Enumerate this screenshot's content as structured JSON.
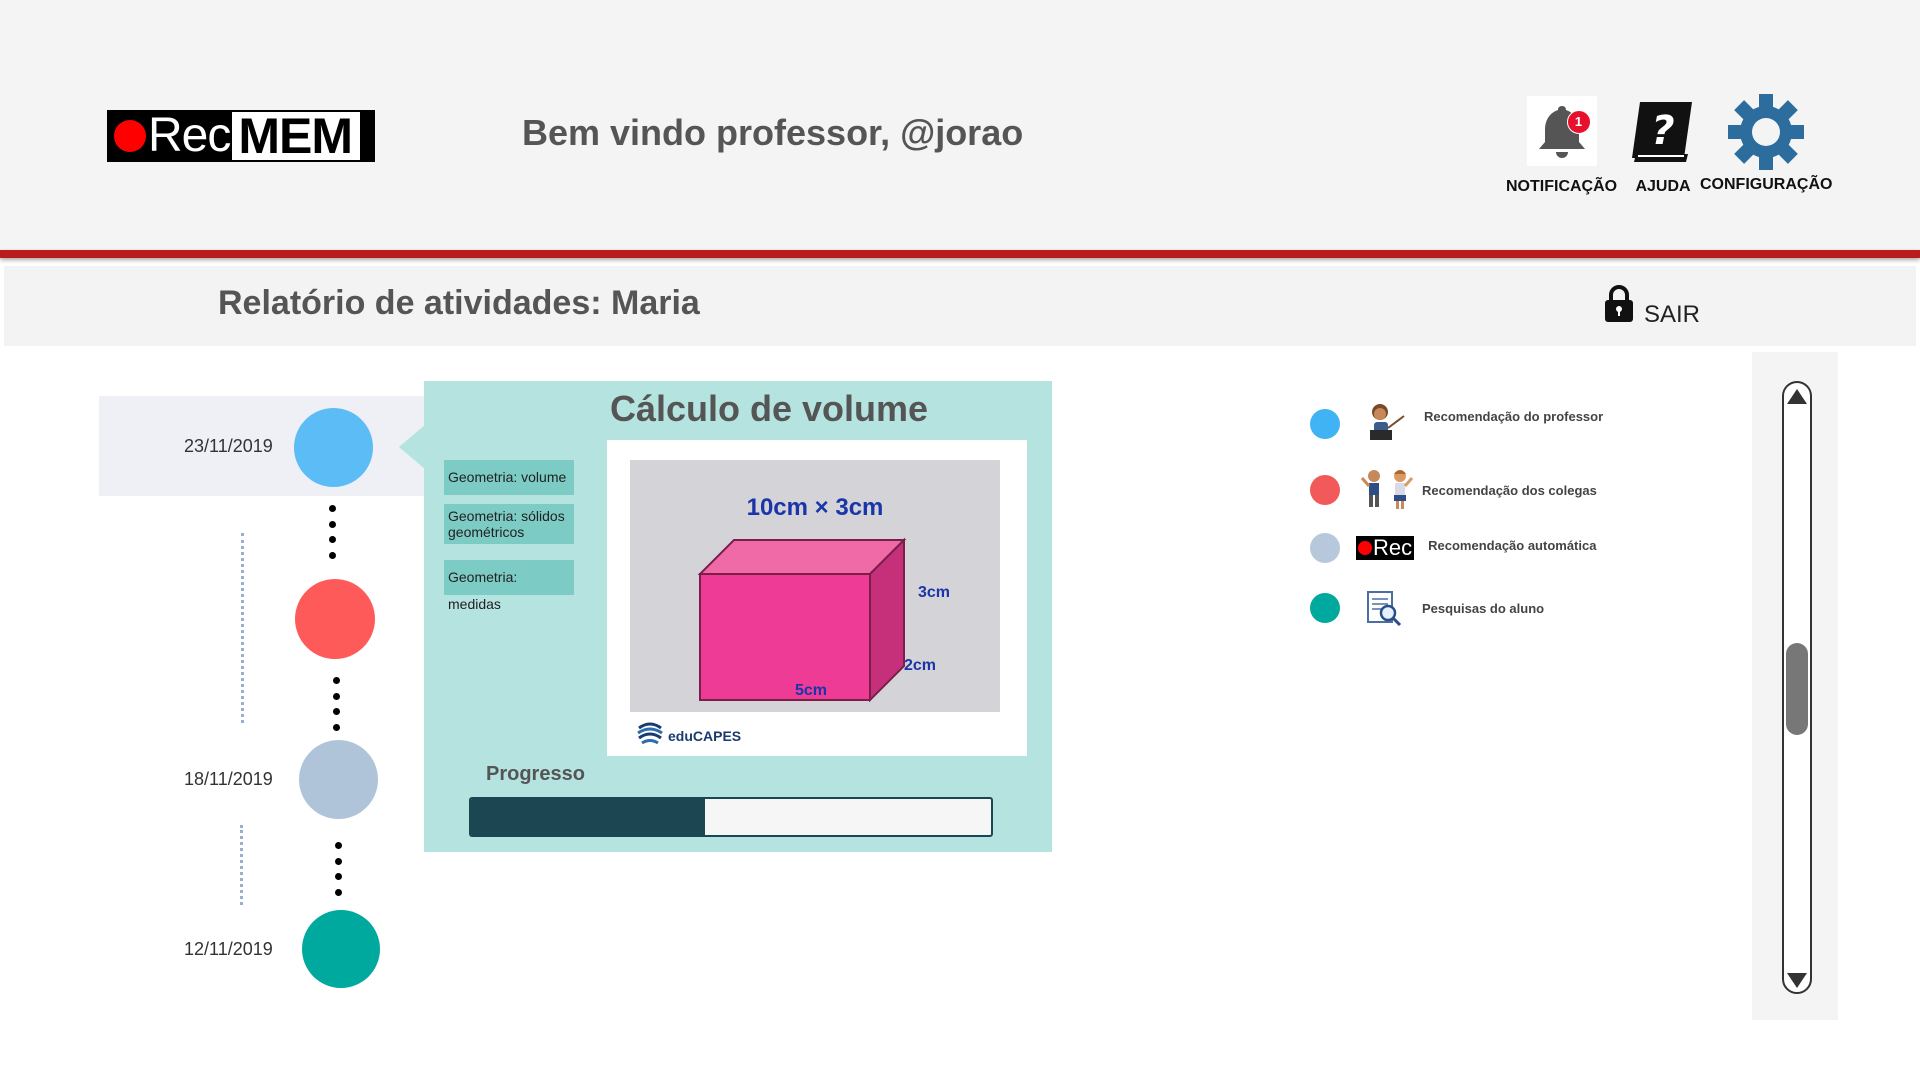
{
  "header": {
    "logo": {
      "rec": "Rec",
      "mem": "MEM"
    },
    "welcome": "Bem vindo professor, @jorao",
    "actions": [
      {
        "label": "NOTIFICAÇÃO",
        "icon": "bell-icon",
        "badge": "1"
      },
      {
        "label": "AJUDA",
        "icon": "help-book-icon"
      },
      {
        "label": "CONFIGURAÇÃO",
        "icon": "gear-icon"
      }
    ]
  },
  "titlebar": {
    "title": "Relatório de atividades: Maria",
    "logout_label": "SAIR"
  },
  "timeline": {
    "entries": [
      {
        "date": "23/11/2019",
        "color": "#5bbcf6",
        "selected": true
      },
      {
        "date": "",
        "color": "#ff5a5a"
      },
      {
        "date": "18/11/2019",
        "color": "#b0c4d9"
      },
      {
        "date": "12/11/2019",
        "color": "#00a99d"
      }
    ]
  },
  "activity": {
    "title": "Cálculo de volume",
    "tags": [
      "Geometria: volume",
      "Geometria: sólidos geométricos",
      "Geometria: medidas"
    ],
    "image": {
      "caption": "10cm × 3cm",
      "height_label": "3cm",
      "depth_label": "2cm",
      "width_label": "5cm",
      "source": "eduCAPES"
    },
    "progress_label": "Progresso",
    "progress": 0.45
  },
  "legend": {
    "items": [
      {
        "label": "Recomendação do professor",
        "color": "#3fb3f3",
        "icon": "teacher-icon"
      },
      {
        "label": "Recomendação dos colegas",
        "color": "#f25a5a",
        "icon": "students-icon"
      },
      {
        "label": "Recomendação automática",
        "color": "#b8c8dc",
        "icon": "rec-logo-icon",
        "icon_text": "Rec"
      },
      {
        "label": "Pesquisas do aluno",
        "color": "#00a99d",
        "icon": "document-search-icon"
      }
    ]
  },
  "colors": {
    "accent_red": "#b81c1c",
    "card_bg": "#b4e3e0",
    "progress": "#1d4653",
    "gear": "#2c6d9e"
  }
}
